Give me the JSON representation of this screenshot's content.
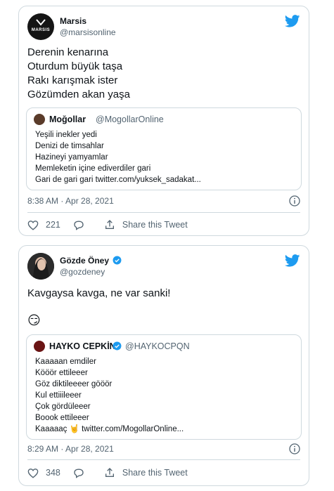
{
  "tweets": [
    {
      "author_name": "Marsis",
      "author_handle": "@marsisonline",
      "avatar_text": "MARSIS",
      "text": "Derenin kenarına\nOturdum büyük taşa\nRakı karışmak ister\nGözümden akan yaşa",
      "quote": {
        "author_name": "Moğollar",
        "author_handle": "@MogollarOnline",
        "text": "Yeşili inekler yedi\nDenizi de timsahlar\nHazineyi yamyamlar\nMemleketin içine ediverdiler gari\nGari de gari gari twitter.com/yuksek_sadakat..."
      },
      "timestamp": "8:38 AM · Apr 28, 2021",
      "like_count": "221",
      "share_label": "Share this Tweet"
    },
    {
      "author_name": "Gözde Öney",
      "author_handle": "@gozdeney",
      "verified": true,
      "text": "Kavgaysa kavga, ne var sanki!",
      "emoji": "😏",
      "quote": {
        "author_name": "HAYKO CEPKİN",
        "author_handle": "@HAYKOCPQN",
        "verified": true,
        "text": "Kaaaaan emdiler\nKööör ettileeer\nGöz diktileeeer gööör\nKul ettiiileeer\nÇok gördüleeer\nBoook ettileeer\nKaaaaaç 🤘 twitter.com/MogollarOnline..."
      },
      "timestamp": "8:29 AM · Apr 28, 2021",
      "like_count": "348",
      "share_label": "Share this Tweet"
    }
  ],
  "colors": {
    "twitter_blue": "#1d9bf0",
    "muted": "#536471",
    "border": "#cfd9de"
  }
}
